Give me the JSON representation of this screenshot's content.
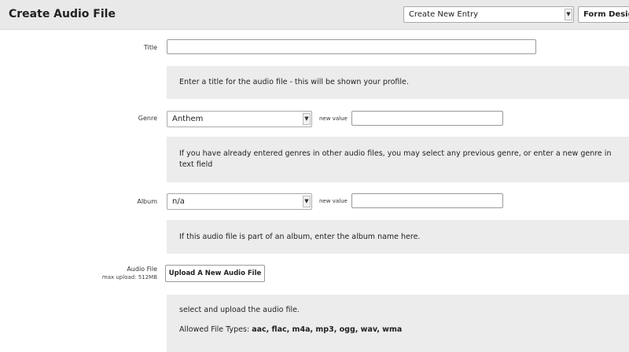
{
  "header": {
    "title": "Create Audio File",
    "entry_select_value": "Create New Entry",
    "form_designer_label": "Form Designer"
  },
  "fields": {
    "title": {
      "label": "Title",
      "value": "",
      "hint": "Enter a title for the audio file - this will be shown your profile."
    },
    "genre": {
      "label": "Genre",
      "selected": "Anthem",
      "new_value_label": "new value",
      "new_value": "",
      "hint": "If you have already entered genres in other audio files, you may select any previous genre, or enter a new genre in text field"
    },
    "album": {
      "label": "Album",
      "selected": "n/a",
      "new_value_label": "new value",
      "new_value": "",
      "hint": "If this audio file is part of an album, enter the album name here."
    },
    "audio_file": {
      "label": "Audio File",
      "sublabel": "max upload: 512MB",
      "button_label": "Upload A New Audio File",
      "hint": "select and upload the audio file.",
      "allowed_types_label": "Allowed File Types:",
      "allowed_types": "aac, flac, m4a, mp3, ogg, wav, wma"
    }
  },
  "icons": {
    "dropdown_arrow": "chevron-down-icon"
  }
}
